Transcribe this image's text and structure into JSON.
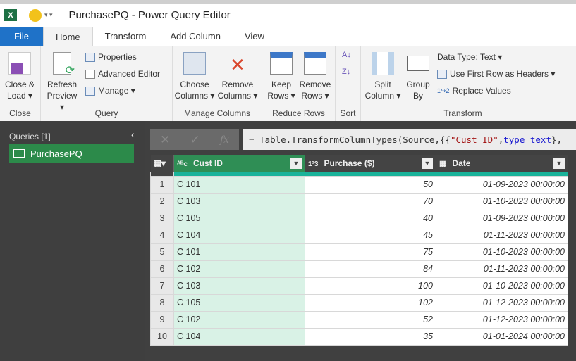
{
  "window": {
    "title": "PurchasePQ - Power Query Editor",
    "app_icon": "excel-icon",
    "feedback_icon": "smiley-icon"
  },
  "tabs": [
    {
      "label": "File"
    },
    {
      "label": "Home"
    },
    {
      "label": "Transform"
    },
    {
      "label": "Add Column"
    },
    {
      "label": "View"
    }
  ],
  "ribbon": {
    "close": {
      "label": "Close",
      "close_load": "Close &",
      "close_load2": "Load ▾"
    },
    "query": {
      "label": "Query",
      "refresh": "Refresh",
      "refresh2": "Preview ▾",
      "properties": "Properties",
      "advanced_editor": "Advanced Editor",
      "manage": "Manage ▾"
    },
    "manage_columns": {
      "label": "Manage Columns",
      "choose": "Choose",
      "choose2": "Columns ▾",
      "remove": "Remove",
      "remove2": "Columns ▾"
    },
    "reduce_rows": {
      "label": "Reduce Rows",
      "keep": "Keep",
      "keep2": "Rows ▾",
      "remove": "Remove",
      "remove2": "Rows ▾"
    },
    "sort": {
      "label": "Sort"
    },
    "transform": {
      "label": "Transform",
      "split": "Split",
      "split2": "Column ▾",
      "group": "Group",
      "group2": "By",
      "data_type": "Data Type: Text ▾",
      "first_row": "Use First Row as Headers ▾",
      "replace": "Replace Values"
    }
  },
  "queries": {
    "header": "Queries [1]",
    "items": [
      {
        "label": "PurchasePQ"
      }
    ]
  },
  "formula": {
    "prefix": "= Table.TransformColumnTypes(Source,{{",
    "str": "\"Cust ID\"",
    "mid": ", ",
    "kw": "type text",
    "suffix": "},"
  },
  "columns": [
    {
      "type_icon": "ABC",
      "label": "Cust ID"
    },
    {
      "type_icon": "123",
      "label": "Purchase ($)"
    },
    {
      "type_icon": "date",
      "label": "Date"
    }
  ],
  "rows": [
    [
      "1",
      "C 101",
      "50",
      "01-09-2023 00:00:00"
    ],
    [
      "2",
      "C 103",
      "70",
      "01-10-2023 00:00:00"
    ],
    [
      "3",
      "C 105",
      "40",
      "01-09-2023 00:00:00"
    ],
    [
      "4",
      "C 104",
      "45",
      "01-11-2023 00:00:00"
    ],
    [
      "5",
      "C 101",
      "75",
      "01-10-2023 00:00:00"
    ],
    [
      "6",
      "C 102",
      "84",
      "01-11-2023 00:00:00"
    ],
    [
      "7",
      "C 103",
      "100",
      "01-10-2023 00:00:00"
    ],
    [
      "8",
      "C 105",
      "102",
      "01-12-2023 00:00:00"
    ],
    [
      "9",
      "C 102",
      "52",
      "01-12-2023 00:00:00"
    ],
    [
      "10",
      "C 104",
      "35",
      "01-01-2024 00:00:00"
    ]
  ]
}
